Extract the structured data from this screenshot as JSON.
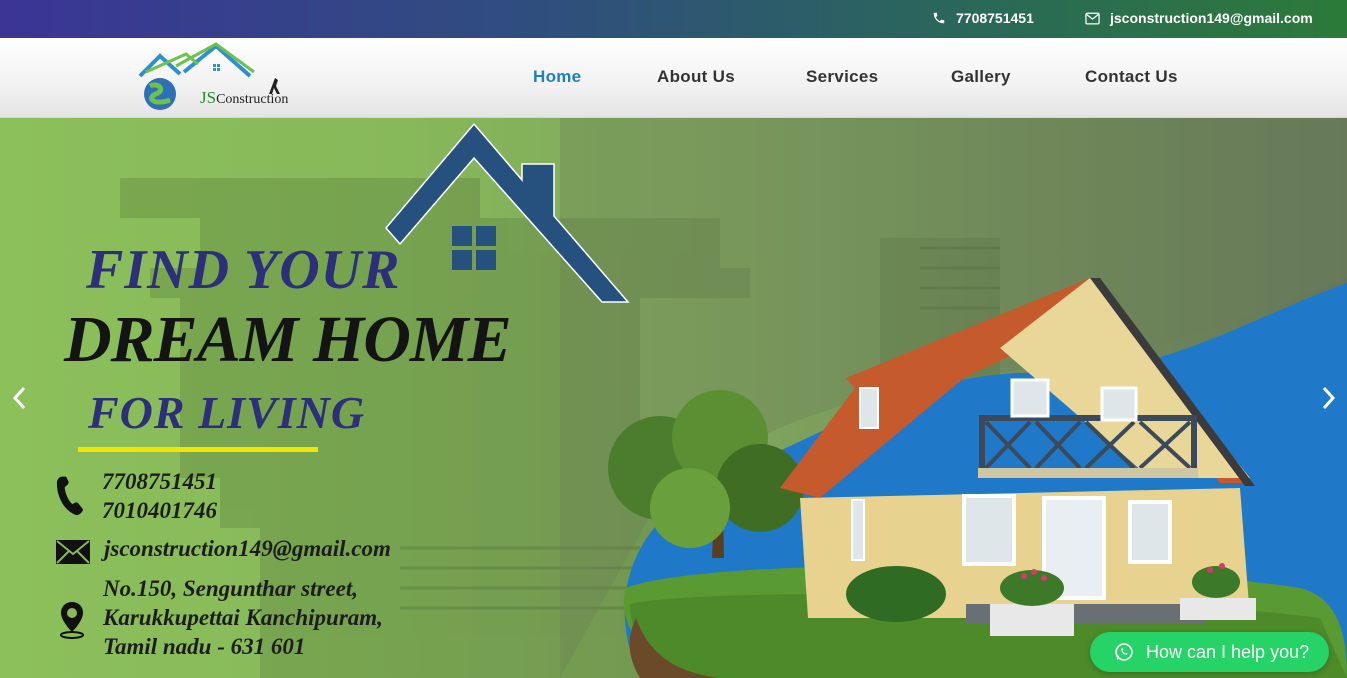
{
  "topbar": {
    "phone": "7708751451",
    "email": "jsconstruction149@gmail.com"
  },
  "logo": {
    "text_js": "JS",
    "text_rest": "Construction"
  },
  "nav": {
    "items": [
      {
        "label": "Home",
        "active": true
      },
      {
        "label": "About Us",
        "active": false
      },
      {
        "label": "Services",
        "active": false
      },
      {
        "label": "Gallery",
        "active": false
      },
      {
        "label": "Contact Us",
        "active": false
      }
    ]
  },
  "hero": {
    "line1": "FIND YOUR",
    "line2": "DREAM HOME",
    "line3": "FOR LIVING",
    "phone1": "7708751451",
    "phone2": "7010401746",
    "email": "jsconstruction149@gmail.com",
    "address_line1": "No.150, Sengunthar street,",
    "address_line2": "Karukkupettai Kanchipuram,",
    "address_line3": "Tamil nadu - 631 601"
  },
  "chat": {
    "label": "How can I help you?"
  },
  "colors": {
    "accent": "#1e7fc4",
    "whatsapp": "#25d366",
    "headline_blue": "#2d2f7a",
    "underline_yellow": "#f1e600"
  },
  "icons": [
    "phone-icon",
    "mail-icon",
    "location-icon",
    "whatsapp-icon",
    "chevron-left-icon",
    "chevron-right-icon"
  ]
}
